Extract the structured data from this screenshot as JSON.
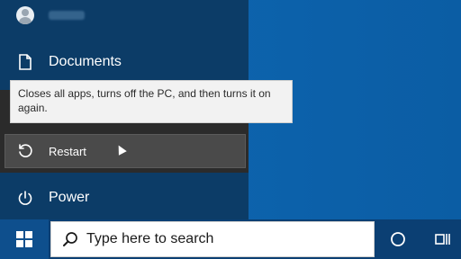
{
  "start_menu": {
    "items": [
      {
        "label": "Documents",
        "icon": "document-icon"
      },
      {
        "label": "Power",
        "icon": "power-icon"
      }
    ],
    "power_menu": {
      "restart_label": "Restart",
      "restart_icon": "restart-icon"
    },
    "tooltip": "Closes all apps, turns off the PC, and then turns it on again."
  },
  "taskbar": {
    "search_placeholder": "Type here to search",
    "start_icon": "windows-logo-icon",
    "cortana_icon": "cortana-icon",
    "task_view_icon": "task-view-icon"
  },
  "colors": {
    "desktop": "#0d63ad",
    "start_menu_bg": "#0c3c67",
    "power_flyout_bg": "#2b2b2b",
    "taskbar_bg": "#0b3f73"
  }
}
